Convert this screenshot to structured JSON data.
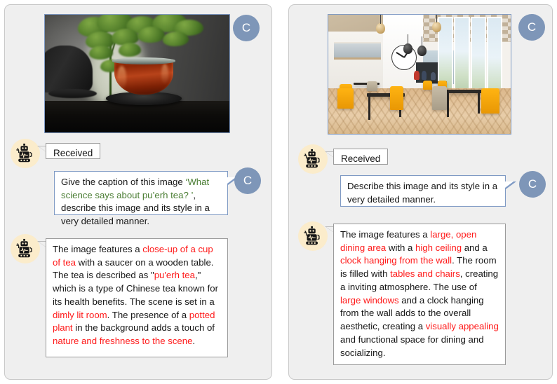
{
  "accent": {
    "panel_bg": "#efefef",
    "panel_border": "#c9c9c9",
    "badge_blue": "#7e96b8",
    "bubble_border_blue": "#7f9ac4",
    "bubble_border_gray": "#9b9b9b",
    "avatar_bg": "#fbeccb",
    "highlight_red": "#ff1a1a",
    "highlight_green": "#4a7d33"
  },
  "badges": {
    "user_initial": "C"
  },
  "left_conversation": {
    "image": {
      "alt": "close-up of a glass cup of dark pu'erh tea on a black saucer with a teapot and a green potted plant behind"
    },
    "received_label": "Received",
    "prompt": {
      "part1": "Give the caption of this image ",
      "quote": "‘What science says about pu’erh tea? ’",
      "part2": ", describe this image and its style in a very detailed manner."
    },
    "answer": {
      "segments": [
        {
          "text": "The image features a ",
          "style": "plain"
        },
        {
          "text": "close-up of a cup of tea",
          "style": "red"
        },
        {
          "text": " with a saucer on a wooden table. The tea is described as \"",
          "style": "plain"
        },
        {
          "text": "pu'erh tea",
          "style": "red"
        },
        {
          "text": ",\" which is a type of Chinese tea known for its health benefits. The scene is set in a ",
          "style": "plain"
        },
        {
          "text": "dimly lit room",
          "style": "red"
        },
        {
          "text": ". The presence of a ",
          "style": "plain"
        },
        {
          "text": "potted plant",
          "style": "red"
        },
        {
          "text": " in the background adds a touch of ",
          "style": "plain"
        },
        {
          "text": "nature and freshness to the scene",
          "style": "red"
        },
        {
          "text": ".",
          "style": "plain"
        }
      ]
    }
  },
  "right_conversation": {
    "image": {
      "alt": "large open dining hall with high checkered ceiling, a wall clock, pendant lamps, large windows and yellow chairs at dark wooden tables on a herringbone wood floor"
    },
    "received_label": "Received",
    "prompt": {
      "text": "Describe this image and its style in a very detailed manner."
    },
    "answer": {
      "segments": [
        {
          "text": "The image features a ",
          "style": "plain"
        },
        {
          "text": "large, open dining area",
          "style": "red"
        },
        {
          "text": " with a ",
          "style": "plain"
        },
        {
          "text": "high ceiling",
          "style": "red"
        },
        {
          "text": " and a ",
          "style": "plain"
        },
        {
          "text": "clock hanging from the wall",
          "style": "red"
        },
        {
          "text": ". The room is filled with ",
          "style": "plain"
        },
        {
          "text": "tables and chairs",
          "style": "red"
        },
        {
          "text": ", creating a inviting atmosphere. The use of ",
          "style": "plain"
        },
        {
          "text": "large windows",
          "style": "red"
        },
        {
          "text": " and a clock hanging from the wall adds to the overall aesthetic, creating a ",
          "style": "plain"
        },
        {
          "text": "visually appealing",
          "style": "red"
        },
        {
          "text": " and functional space for dining and socializing.",
          "style": "plain"
        }
      ]
    }
  }
}
